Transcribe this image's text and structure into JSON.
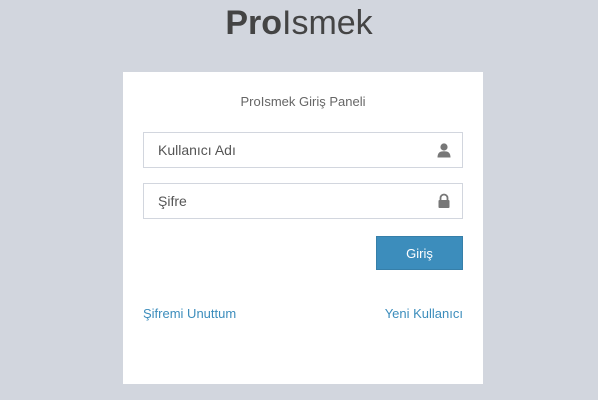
{
  "logo": {
    "bold": "Pro",
    "light": "Ismek"
  },
  "login_box": {
    "title": "ProIsmek Giriş Paneli",
    "username_placeholder": "Kullanıcı Adı",
    "password_placeholder": "Şifre",
    "login_button": "Giriş",
    "forgot_password": "Şifremi Unuttum",
    "new_user": "Yeni Kullanıcı"
  },
  "icons": {
    "username": "user-icon",
    "password": "lock-icon"
  },
  "colors": {
    "background": "#d2d6de",
    "accent": "#3c8dbc",
    "text": "#444444"
  }
}
